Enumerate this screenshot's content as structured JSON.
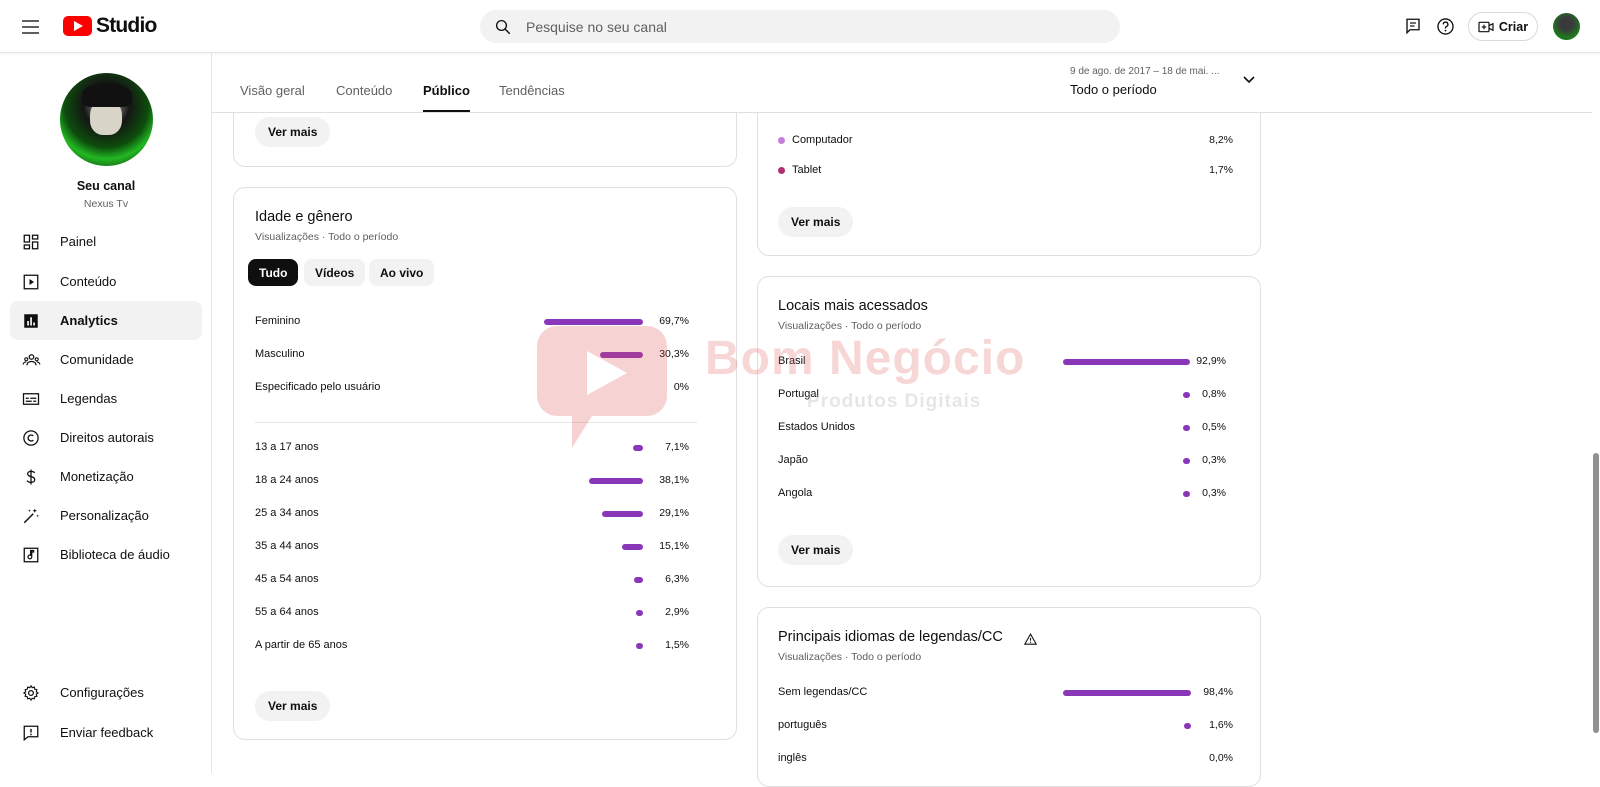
{
  "app": {
    "name": "Studio"
  },
  "search": {
    "placeholder": "Pesquise no seu canal"
  },
  "header": {
    "create_label": "Criar"
  },
  "channel": {
    "title": "Seu canal",
    "name": "Nexus Tv"
  },
  "sidebar": {
    "items": [
      {
        "label": "Painel",
        "icon": "dashboard-icon"
      },
      {
        "label": "Conteúdo",
        "icon": "content-icon"
      },
      {
        "label": "Analytics",
        "icon": "analytics-icon",
        "active": true
      },
      {
        "label": "Comunidade",
        "icon": "community-icon"
      },
      {
        "label": "Legendas",
        "icon": "subtitles-icon"
      },
      {
        "label": "Direitos autorais",
        "icon": "copyright-icon"
      },
      {
        "label": "Monetização",
        "icon": "dollar-icon"
      },
      {
        "label": "Personalização",
        "icon": "magic-wand-icon"
      },
      {
        "label": "Biblioteca de áudio",
        "icon": "audio-library-icon"
      }
    ],
    "bottom": [
      {
        "label": "Configurações",
        "icon": "gear-icon"
      },
      {
        "label": "Enviar feedback",
        "icon": "feedback-icon"
      }
    ]
  },
  "tabs": [
    {
      "label": "Visão geral"
    },
    {
      "label": "Conteúdo"
    },
    {
      "label": "Público",
      "active": true
    },
    {
      "label": "Tendências"
    }
  ],
  "date": {
    "range": "9 de ago. de 2017 – 18 de mai. ...",
    "period": "Todo o período"
  },
  "common": {
    "see_more": "Ver mais"
  },
  "age_gender": {
    "title": "Idade e gênero",
    "subtitle": "Visualizações · Todo o período",
    "chips": [
      "Tudo",
      "Vídeos",
      "Ao vivo"
    ],
    "gender": [
      {
        "label": "Feminino",
        "value": "69,7%",
        "pct": 69.7
      },
      {
        "label": "Masculino",
        "value": "30,3%",
        "pct": 30.3
      },
      {
        "label": "Especificado pelo usuário",
        "value": "0%",
        "pct": 0
      }
    ],
    "age": [
      {
        "label": "13 a 17 anos",
        "value": "7,1%",
        "pct": 7.1
      },
      {
        "label": "18 a 24 anos",
        "value": "38,1%",
        "pct": 38.1
      },
      {
        "label": "25 a 34 anos",
        "value": "29,1%",
        "pct": 29.1
      },
      {
        "label": "35 a 44 anos",
        "value": "15,1%",
        "pct": 15.1
      },
      {
        "label": "45 a 54 anos",
        "value": "6,3%",
        "pct": 6.3
      },
      {
        "label": "55 a 64 anos",
        "value": "2,9%",
        "pct": 2.9
      },
      {
        "label": "A partir de 65 anos",
        "value": "1,5%",
        "pct": 1.5
      }
    ]
  },
  "devices": {
    "rows": [
      {
        "label": "Computador",
        "value": "8,2%",
        "color": "#c77dd9"
      },
      {
        "label": "Tablet",
        "value": "1,7%",
        "color": "#b0306f"
      }
    ]
  },
  "locations": {
    "title": "Locais mais acessados",
    "subtitle": "Visualizações · Todo o período",
    "rows": [
      {
        "label": "Brasil",
        "value": "92,9%",
        "pct": 92.9
      },
      {
        "label": "Portugal",
        "value": "0,8%",
        "pct": 0.8
      },
      {
        "label": "Estados Unidos",
        "value": "0,5%",
        "pct": 0.5
      },
      {
        "label": "Japão",
        "value": "0,3%",
        "pct": 0.3
      },
      {
        "label": "Angola",
        "value": "0,3%",
        "pct": 0.3
      }
    ]
  },
  "languages": {
    "title": "Principais idiomas de legendas/CC",
    "subtitle": "Visualizações · Todo o período",
    "rows": [
      {
        "label": "Sem legendas/CC",
        "value": "98,4%",
        "pct": 98.4
      },
      {
        "label": "português",
        "value": "1,6%",
        "pct": 1.6
      },
      {
        "label": "inglês",
        "value": "0,0%",
        "pct": 0
      }
    ]
  },
  "watermark": {
    "brand": "Bom Negócio",
    "tagline": "Produtos Digitais"
  },
  "colors": {
    "bar": "#8936b8",
    "accent_red": "#ff0000"
  }
}
